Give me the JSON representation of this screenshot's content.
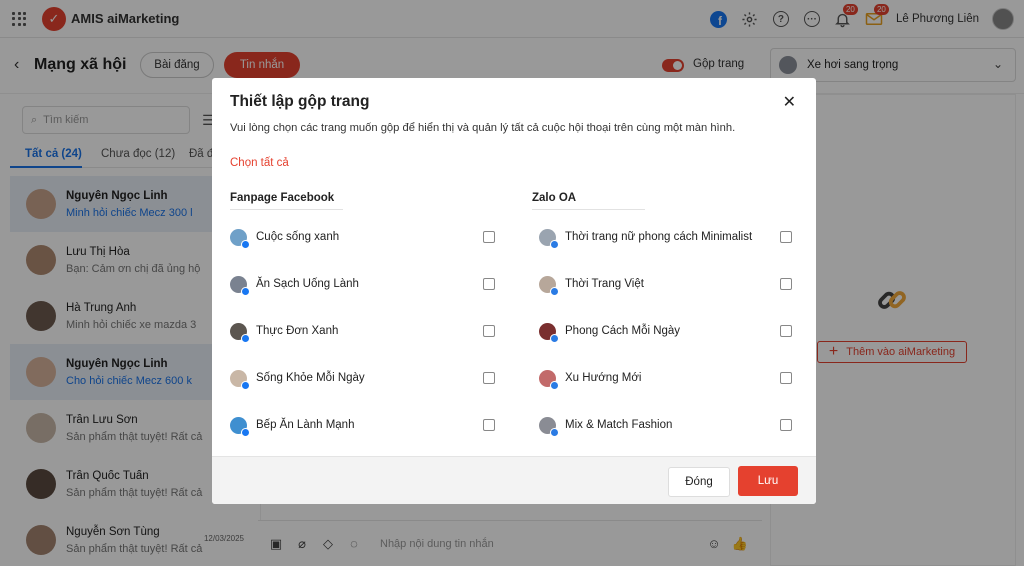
{
  "app": {
    "name": "AMIS aiMarketing",
    "user_name": "Lê Phương Liên",
    "bell_badge": "20",
    "mail_badge": "20"
  },
  "subbar": {
    "back": "‹",
    "title": "Mạng xã hội",
    "tab_posts": "Bài đăng",
    "tab_messages": "Tin nhắn",
    "merge_label": "Gộp trang",
    "selected_page": "Xe hơi sang trọng"
  },
  "left": {
    "search_placeholder": "Tìm kiếm",
    "tabs": [
      "Tất cả (24)",
      "Chưa đọc (12)",
      "Đã đ"
    ],
    "conversations": [
      {
        "name": "Nguyễn Ngọc Linh",
        "msg": "Minh hỏi chiếc Mecz 300 l",
        "selected": true,
        "date": ""
      },
      {
        "name": "Lưu Thị Hòa",
        "msg": "Bạn: Cảm ơn chị đã ủng hộ",
        "selected": false,
        "date": ""
      },
      {
        "name": "Hà Trung Anh",
        "msg": "Minh hỏi chiếc xe mazda 3",
        "selected": false,
        "date": ""
      },
      {
        "name": "Nguyễn Ngọc Linh",
        "msg": "Cho hỏi chiếc Mecz 600 k",
        "selected": true,
        "date": ""
      },
      {
        "name": "Trần Lưu Sơn",
        "msg": "Sản phẩm thật tuyệt! Rất cả",
        "selected": false,
        "date": ""
      },
      {
        "name": "Trần Quốc Tuấn",
        "msg": "Sản phẩm thật tuyệt! Rất cả",
        "selected": false,
        "date": ""
      },
      {
        "name": "Nguyễn Sơn Tùng",
        "msg": "Sản phẩm thật tuyệt! Rất cả",
        "selected": false,
        "date": "12/03/2025"
      }
    ]
  },
  "composer": {
    "placeholder": "Nhập nội dung tin nhắn"
  },
  "right": {
    "add_button": "Thêm vào aiMarketing"
  },
  "modal": {
    "title": "Thiết lập gộp trang",
    "close": "✕",
    "description": "Vui lòng chọn các trang muốn gộp để hiển thị và quản lý tất cả cuộc hội thoại trên cùng một màn hình.",
    "select_all": "Chọn tất cả",
    "facebook_title": "Fanpage Facebook",
    "zalo_title": "Zalo OA",
    "facebook_pages": [
      "Cuộc sống xanh",
      "Ăn Sạch Uống Lành",
      "Thực Đơn Xanh",
      "Sống Khỏe Mỗi Ngày",
      "Bếp Ăn Lành Mạnh"
    ],
    "zalo_pages": [
      "Thời trang nữ phong cách Minimalist",
      "Thời Trang Việt",
      "Phong Cách Mỗi Ngày",
      "Xu Hướng Mới",
      "Mix & Match Fashion"
    ],
    "btn_close": "Đóng",
    "btn_save": "Lưu"
  }
}
